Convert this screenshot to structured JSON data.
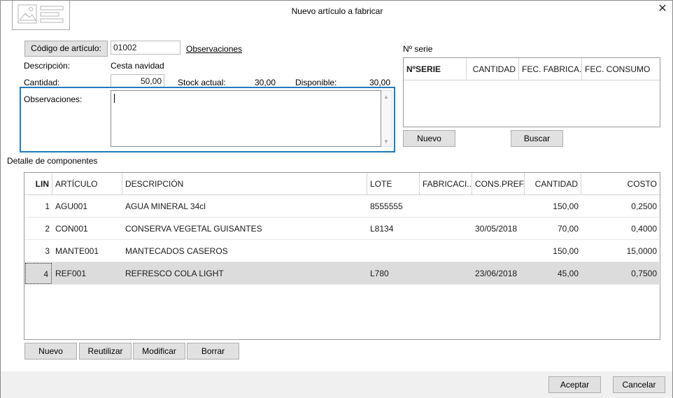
{
  "window": {
    "title": "Nuevo artículo a fabricar"
  },
  "article": {
    "code_button": "Código de artículo:",
    "code_value": "01002",
    "observaciones_link": "Observaciones",
    "description_label": "Descripción:",
    "description_value": "Cesta navidad",
    "quantity_label": "Cantidad:",
    "quantity_value": "50,00",
    "stock_label": "Stock actual:",
    "stock_value": "30,00",
    "available_label": "Disponible:",
    "available_value": "30,00",
    "obs_label": "Observaciones:",
    "obs_value": ""
  },
  "serial": {
    "title": "Nº serie",
    "columns": [
      "NºSERIE",
      "CANTIDAD",
      "FEC. FABRICA...",
      "FEC. CONSUMO"
    ],
    "new_button": "Nuevo",
    "search_button": "Buscar"
  },
  "components": {
    "title": "Detalle de componentes",
    "columns": [
      "LIN",
      "ARTÍCULO",
      "DESCRIPCIÓN",
      "LOTE",
      "FABRICACI...",
      "CONS.PREF.",
      "CANTIDAD",
      "COSTO"
    ],
    "rows": [
      {
        "lin": "1",
        "articulo": "AGU001",
        "descripcion": "AGUA MINERAL 34cl",
        "lote": "8555555",
        "fabricacion": "",
        "cons_pref": "",
        "cantidad": "150,00",
        "costo": "0,2500"
      },
      {
        "lin": "2",
        "articulo": "CON001",
        "descripcion": "CONSERVA VEGETAL GUISANTES",
        "lote": "L8134",
        "fabricacion": "",
        "cons_pref": "30/05/2018",
        "cantidad": "70,00",
        "costo": "0,4000"
      },
      {
        "lin": "3",
        "articulo": "MANTE001",
        "descripcion": "MANTECADOS CASEROS",
        "lote": "",
        "fabricacion": "",
        "cons_pref": "",
        "cantidad": "150,00",
        "costo": "15,0000"
      },
      {
        "lin": "4",
        "articulo": "REF001",
        "descripcion": "REFRESCO COLA LIGHT",
        "lote": "L780",
        "fabricacion": "",
        "cons_pref": "23/06/2018",
        "cantidad": "45,00",
        "costo": "0,7500"
      }
    ],
    "buttons": {
      "new": "Nuevo",
      "reuse": "Reutilizar",
      "modify": "Modificar",
      "delete": "Borrar"
    }
  },
  "footer": {
    "accept": "Aceptar",
    "cancel": "Cancelar"
  },
  "colors": {
    "focus_border": "#1f7bbf",
    "selected_row": "#dcdcdc",
    "button_bg": "#e1e1e1"
  }
}
